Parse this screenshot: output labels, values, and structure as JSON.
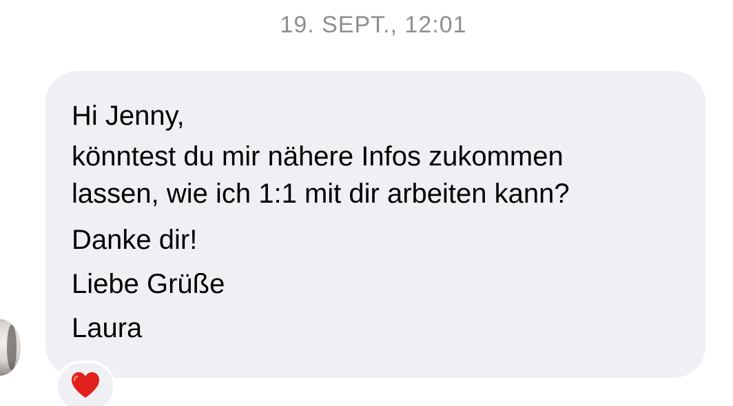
{
  "conversation": {
    "timestamp": "19. SEPT., 12:01",
    "message": {
      "lines": [
        "Hi Jenny,",
        "könntest du mir nähere Infos zukommen",
        "lassen, wie ich 1:1 mit dir arbeiten kann?",
        "Danke dir!",
        "Liebe Grüße",
        "Laura"
      ],
      "bubble_color": "#efeff4"
    },
    "reaction": {
      "icon": "red-heart-icon",
      "color": "#e0201c"
    },
    "sender_avatar": {
      "icon": "profile-photo"
    }
  }
}
